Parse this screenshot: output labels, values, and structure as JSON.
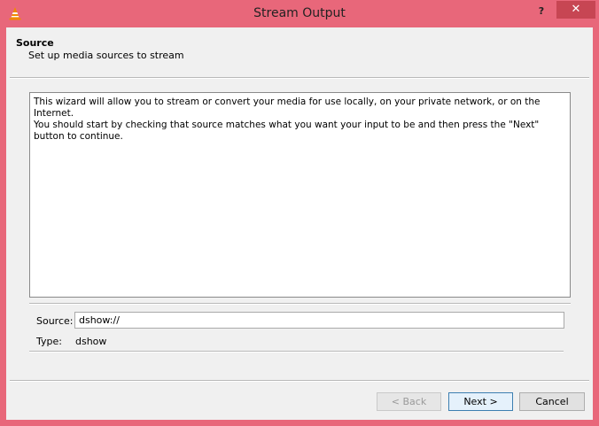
{
  "window": {
    "title": "Stream Output",
    "help_label": "?",
    "close_label": "✕"
  },
  "header": {
    "title": "Source",
    "subtitle": "Set up media sources to stream"
  },
  "description": "This wizard will allow you to stream or convert your media for use locally, on your private network, or on the Internet.\nYou should start by checking that source matches what you want your input to be and then press the \"Next\" button to continue.",
  "source": {
    "label": "Source:",
    "value": "dshow://"
  },
  "type": {
    "label": "Type:",
    "value": "dshow"
  },
  "buttons": {
    "back": "< Back",
    "next": "Next >",
    "cancel": "Cancel"
  },
  "colors": {
    "frame": "#e8677a",
    "close": "#c74653",
    "accent": "#3c7fb1"
  },
  "icons": {
    "app": "vlc-cone-icon"
  }
}
